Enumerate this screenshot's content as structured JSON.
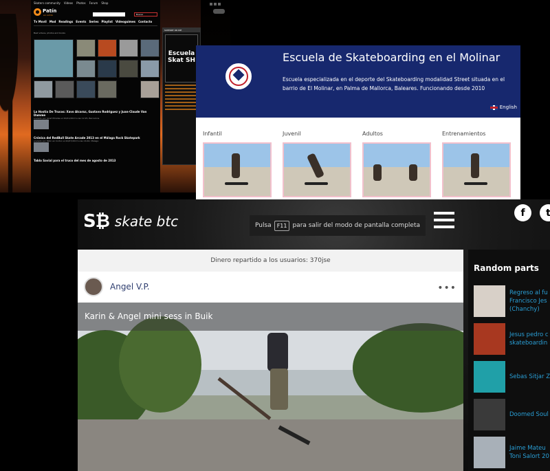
{
  "patin": {
    "topbar": [
      "Skaters community",
      "Videos",
      "Photos",
      "Forum",
      "Shop"
    ],
    "logo_text": "Patín",
    "logo_sub": "en cortón",
    "search_button": "Buscar",
    "nav": [
      "Tv Movil",
      "Mod",
      "Readings",
      "Events",
      "Series",
      "Playlist",
      "Videoguimes",
      "Contacto"
    ],
    "gallery_caption": "Best videos, photos and books",
    "news": [
      {
        "title": "La Hostia De Trucos: Xavo Alcaraz, Gustavo Rodriguez y Juan-Claude Van Damme",
        "meta": "enviado por Jonet Miralles el 20/01/2013 a las 12:25, Barcelona"
      },
      {
        "title": "Crónica del RedBull Skate Arcade 2013 en el Málaga Rock Skatepark",
        "meta": "enviado por Patin en Corton el 20/07/2013 a las 16:40, Málaga"
      },
      {
        "title": "Tabla Savial para el truco del mes de agosto de 2013",
        "meta": ""
      }
    ],
    "sidebar_header": "SUPPORT OR DIE",
    "sidebar_ad": "Escuela Skat SH"
  },
  "escuela": {
    "title": "Escuela de Skateboarding en el Molinar",
    "description": "Escuela especializada en el deporte del Skateboarding modalidad Street situada en el barrio de El Molinar, en Palma de Mallorca, Baleares. Funcionando desde 2010",
    "language": "English",
    "categories": [
      "Infantil",
      "Juvenil",
      "Adultos",
      "Entrenamientos"
    ]
  },
  "skatebtc": {
    "logo_mark": "S₿",
    "brand": "skate btc",
    "fullscreen_prefix": "Pulsa",
    "fullscreen_key": "F11",
    "fullscreen_suffix": "para salir del modo de pantalla completa",
    "social": [
      "f",
      "t"
    ],
    "dinero": "Dinero repartido a los usuarios: 370jse",
    "user_name": "Angel V.P.",
    "more_label": "•••",
    "video_title": "Karin & Angel mini sess in Buik",
    "random_header": "Random parts",
    "random_parts": [
      {
        "label": "Regreso al fu Francisco Jes (Chanchy)",
        "color": "#d8d0c8"
      },
      {
        "label": "Jesus pedro c skateboardin",
        "color": "#a83820"
      },
      {
        "label": "Sebas Sitjar Z",
        "color": "#20a0a8"
      },
      {
        "label": "Doomed Soul",
        "color": "#3a3a3a"
      },
      {
        "label": "Jaime Mateu Toni Salort 20",
        "color": "#a8b0b8"
      }
    ]
  }
}
